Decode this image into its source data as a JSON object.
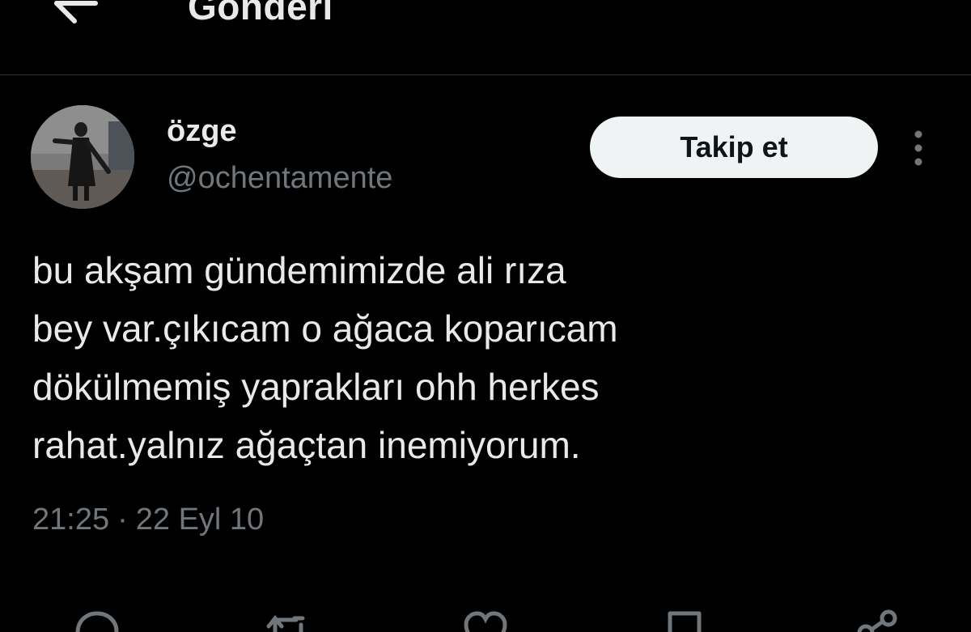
{
  "header": {
    "title": "Gönderi",
    "back_icon": "arrow-left-icon"
  },
  "author": {
    "display_name": "özge",
    "handle": "@ochentamente",
    "follow_label": "Takip et",
    "more_icon": "more-vertical-icon"
  },
  "tweet": {
    "text": "bu akşam gündemimizde ali rıza\nbey var.çıkıcam o ağaca koparıcam\ndökülmemiş yaprakları ohh herkes\nrahat.yalnız ağaçtan inemiyorum.",
    "time": "21:25",
    "separator": "·",
    "date": "22 Eyl 10"
  },
  "actions": [
    {
      "icon": "reply-icon"
    },
    {
      "icon": "retweet-icon"
    },
    {
      "icon": "like-icon"
    },
    {
      "icon": "bookmark-icon"
    },
    {
      "icon": "share-icon"
    }
  ],
  "colors": {
    "background": "#000000",
    "primary_text": "#e7e9ea",
    "secondary_text": "#71767b",
    "divider": "#2f3336",
    "follow_button_bg": "#eff3f4",
    "follow_button_text": "#0f1419"
  }
}
